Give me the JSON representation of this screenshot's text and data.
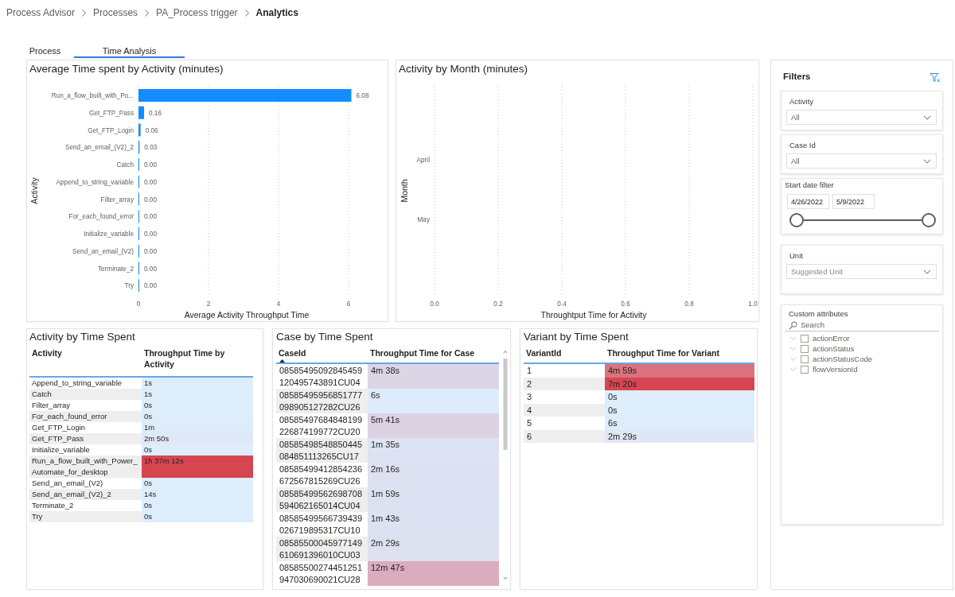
{
  "breadcrumb": [
    {
      "label": "Process Advisor",
      "current": false
    },
    {
      "label": "Processes",
      "current": false
    },
    {
      "label": "PA_Process trigger",
      "current": false
    },
    {
      "label": "Analytics",
      "current": true
    }
  ],
  "tabs": [
    {
      "label": "Process",
      "selected": false
    },
    {
      "label": "Time Analysis",
      "selected": true
    }
  ],
  "avg_time_panel": {
    "title": "Average Time spent by Activity (minutes)",
    "chart_data": {
      "type": "bar",
      "orientation": "horizontal",
      "categories": [
        "Run_a_flow_built_with_Po...",
        "Get_FTP_Pass",
        "Get_FTP_Login",
        "Send_an_email_(V2)_2",
        "Catch",
        "Append_to_string_variable",
        "Filter_array",
        "For_each_found_error",
        "Initialize_variable",
        "Send_an_email_(V2)",
        "Terminate_2",
        "Try"
      ],
      "values": [
        6.08,
        0.16,
        0.06,
        0.03,
        0,
        0,
        0,
        0,
        0,
        0,
        0,
        0
      ],
      "data_labels": true,
      "value_labels": [
        "6.08",
        "0.16",
        "0.06",
        "0.03",
        "0.00",
        "0.00",
        "0.00",
        "0.00",
        "0.00",
        "0.00",
        "0.00",
        "0.00"
      ],
      "color": "#118dff",
      "xlabel": "Average Activity Throughput Time",
      "ylabel": "Activity",
      "xticks": [
        0,
        2,
        4,
        6
      ],
      "xlim": [
        0,
        6.08
      ],
      "grid": true
    }
  },
  "month_panel": {
    "title": "Activity by Month (minutes)",
    "chart_data": {
      "type": "bar",
      "orientation": "horizontal",
      "categories": [
        "April",
        "May"
      ],
      "values": [
        null,
        null
      ],
      "xlabel": "Throughtput Time for Activity",
      "ylabel": "Month",
      "xticks": [
        {
          "value": 0,
          "label": "0.0"
        },
        {
          "value": 0.2,
          "label": "0.2"
        },
        {
          "value": 0.4,
          "label": "0.4"
        },
        {
          "value": 0.6,
          "label": "0.6"
        },
        {
          "value": 0.8,
          "label": "0.8"
        },
        {
          "value": 1,
          "label": "1.0"
        }
      ],
      "xlim": [
        0,
        1
      ],
      "grid": true
    }
  },
  "activity_table": {
    "title": "Activity by Time Spent",
    "columns": [
      {
        "label": "Activity"
      },
      {
        "label": "Throughput Time by Activity"
      }
    ],
    "rows": [
      {
        "cells": [
          "Append_to_string_variable",
          "1s"
        ],
        "color": "#deedfc"
      },
      {
        "cells": [
          "Catch",
          "1s"
        ],
        "color": "#deedfc"
      },
      {
        "cells": [
          "Filter_array",
          "0s"
        ],
        "color": "#deedfc"
      },
      {
        "cells": [
          "For_each_found_error",
          "0s"
        ],
        "color": "#deedfc"
      },
      {
        "cells": [
          "Get_FTP_Login",
          "1m"
        ],
        "color": "#deebfb"
      },
      {
        "cells": [
          "Get_FTP_Pass",
          "2m 50s"
        ],
        "color": "#e0e7f6"
      },
      {
        "cells": [
          "Initialize_variable",
          "0s"
        ],
        "color": "#deedfc"
      },
      {
        "cells": [
          "Run_a_flow_built_with_Power_Automate_for_desktop",
          "1h 37m 12s"
        ],
        "color": "#d64550"
      },
      {
        "cells": [
          "Send_an_email_(V2)",
          "0s"
        ],
        "color": "#deedfc"
      },
      {
        "cells": [
          "Send_an_email_(V2)_2",
          "14s"
        ],
        "color": "#deedfc"
      },
      {
        "cells": [
          "Terminate_2",
          "0s"
        ],
        "color": "#deedfc"
      },
      {
        "cells": [
          "Try",
          "0s"
        ],
        "color": "#deedfc"
      }
    ]
  },
  "case_table": {
    "title": "Case by Time Spent",
    "columns": [
      {
        "label": "CaseId",
        "sorted": true
      },
      {
        "label": "Throughput Time for Case",
        "sorted": false
      }
    ],
    "rows": [
      {
        "cells": [
          "08585495092845459120495743891CU04",
          "4m 38s"
        ],
        "color": "#dcd5e5"
      },
      {
        "cells": [
          "08585495956851777098905127282CU26",
          "6s"
        ],
        "color": "#ddecfb"
      },
      {
        "cells": [
          "08585497684848199226874199772CU20",
          "5m 41s"
        ],
        "color": "#dcd2e2"
      },
      {
        "cells": [
          "08585498548850445084851113265CU17",
          "1m 35s"
        ],
        "color": "#dde3f3"
      },
      {
        "cells": [
          "08585499412854236672567815269CU26",
          "2m 16s"
        ],
        "color": "#dde0f0"
      },
      {
        "cells": [
          "08585499562698708594062165014CU04",
          "1m 59s"
        ],
        "color": "#dde2f2"
      },
      {
        "cells": [
          "08585499566739439026719895317CU10",
          "1m 43s"
        ],
        "color": "#dde2f2"
      },
      {
        "cells": [
          "08585500045977149610691396010CU03",
          "2m 29s"
        ],
        "color": "#dde0ef"
      },
      {
        "cells": [
          "08585500274451251947030690021CU28",
          "12m 47s"
        ],
        "color": "#dbacbd"
      }
    ]
  },
  "variant_table": {
    "title": "Variant by Time Spent",
    "columns": [
      {
        "label": "VariantId"
      },
      {
        "label": "Throughput Time for Variant"
      }
    ],
    "rows": [
      {
        "cells": [
          "1",
          "4m 59s"
        ],
        "color": "#db727d"
      },
      {
        "cells": [
          "2",
          "7m 20s"
        ],
        "color": "#d64550"
      },
      {
        "cells": [
          "3",
          "0s"
        ],
        "color": "#deedfc"
      },
      {
        "cells": [
          "4",
          "0s"
        ],
        "color": "#deedfc"
      },
      {
        "cells": [
          "5",
          "6s"
        ],
        "color": "#deecfb"
      },
      {
        "cells": [
          "6",
          "2m 29s"
        ],
        "color": "#dfe6f5"
      }
    ]
  },
  "filters": {
    "title": "Filters",
    "slicers": [
      {
        "kind": "dropdown",
        "label": "Activity",
        "value": "All"
      },
      {
        "kind": "dropdown",
        "label": "Case Id",
        "value": "All"
      },
      {
        "kind": "date_range",
        "label": "Start date filter",
        "from": "4/26/2022",
        "to": "5/9/2022",
        "level": 1
      },
      {
        "kind": "dropdown",
        "label": "Unit",
        "placeholder": "Suggested Unit"
      },
      {
        "kind": "attribute_list",
        "label": "Custom attributes",
        "search": {
          "placeholder": "Search"
        },
        "items": [
          {
            "label": "actionError",
            "checked": false
          },
          {
            "label": "actionStatus",
            "checked": false
          },
          {
            "label": "actionStatusCode",
            "checked": false
          },
          {
            "label": "flowVersionId",
            "checked": false
          }
        ]
      }
    ]
  }
}
